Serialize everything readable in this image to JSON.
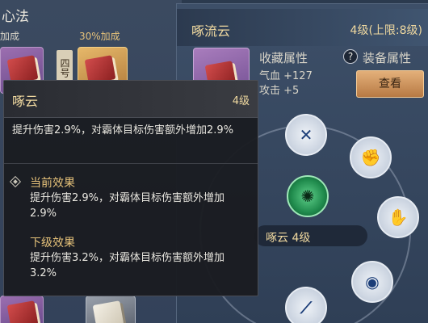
{
  "left": {
    "title": "心法",
    "bonus_a": "加成",
    "bonus_b": "30%加成",
    "side_tag": "四号"
  },
  "panel": {
    "name": "啄流云",
    "level": "4级(上限:8级)",
    "collect_label": "收藏属性",
    "stats": [
      "气血 +127",
      "攻击 +5"
    ],
    "help_symbol": "?",
    "equip_label": "装备属性",
    "view_button": "查看",
    "center_label": "啄云  4级"
  },
  "tooltip": {
    "name": "啄云",
    "level": "4级",
    "description": "提升伤害2.9%，对霸体目标伤害额外增加2.9%",
    "current_title": "当前效果",
    "current_text": "提升伤害2.9%，对霸体目标伤害额外增加2.9%",
    "next_title": "下级效果",
    "next_text": "提升伤害3.2%，对霸体目标伤害额外增加3.2%"
  },
  "colors": {
    "accent_gold": "#f0d9a0",
    "effect_title": "#e6c27a",
    "button": "#d49a5e",
    "center_node": "#2fae64"
  },
  "icons": {
    "wheel": [
      "crossed-blades-icon",
      "fist-icon",
      "palm-icon",
      "eye-sigil-icon",
      "staff-icon",
      "scorpion-icon"
    ]
  }
}
